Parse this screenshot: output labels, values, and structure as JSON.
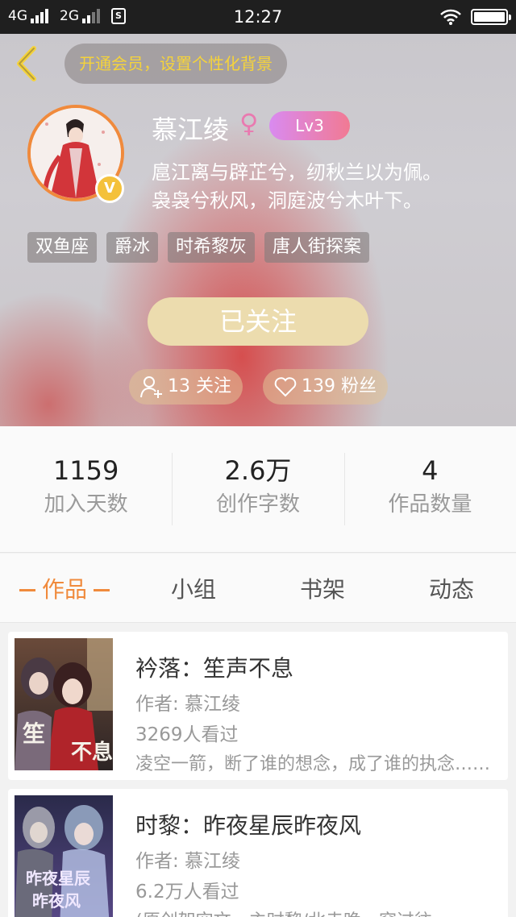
{
  "status_bar": {
    "net1": "4G",
    "net2": "2G",
    "time": "12:27",
    "sim_icon": "sim-card-icon",
    "battery_level": 1.0
  },
  "header": {
    "vip_banner": "开通会员，设置个性化背景",
    "name": "慕江绫",
    "gender_symbol": "♀",
    "level": "Lv3",
    "verified_badge": "V",
    "bio_line1": "扈江离与辟芷兮，纫秋兰以为佩。",
    "bio_line2": "袅袅兮秋风，洞庭波兮木叶下。",
    "tags": [
      "双鱼座",
      "爵冰",
      "时希黎灰",
      "唐人街探案"
    ],
    "follow_button": "已关注",
    "following": "13 关注",
    "fans": "139 粉丝",
    "accent_color": "#f08a3c"
  },
  "stats": [
    {
      "value": "1159",
      "label": "加入天数"
    },
    {
      "value": "2.6万",
      "label": "创作字数"
    },
    {
      "value": "4",
      "label": "作品数量"
    }
  ],
  "tabs": {
    "works": "作品",
    "group": "小组",
    "bookshelf": "书架",
    "activity": "动态"
  },
  "books": [
    {
      "title": "衿落：笙声不息",
      "author": "作者: 慕江绫",
      "views": "3269人看过",
      "desc": "凌空一箭，断了谁的想念，成了谁的执念……",
      "cover_text": "笙声不息"
    },
    {
      "title": "时黎：昨夜星辰昨夜风",
      "author": "作者: 慕江绫",
      "views": "6.2万人看过",
      "desc": "(原创架空文，主时黎/北寺晚，穿过往……",
      "cover_text": "昨夜星辰昨夜风"
    }
  ]
}
